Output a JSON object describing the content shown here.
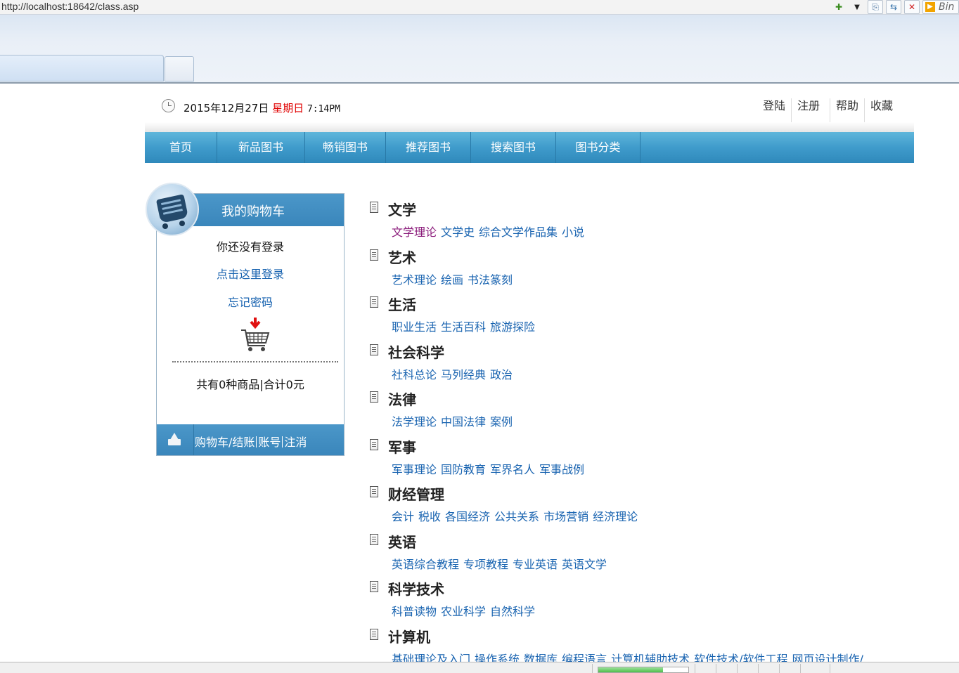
{
  "browser": {
    "url": "http://localhost:18642/class.asp",
    "right_tag": "Bin"
  },
  "topbar": {
    "date": "2015年12月27日",
    "weekday": "星期日",
    "time": "7:14PM",
    "links": [
      "登陆",
      "注册",
      "帮助",
      "收藏"
    ]
  },
  "nav": {
    "items": [
      "首页",
      "新品图书",
      "畅销图书",
      "推荐图书",
      "搜索图书",
      "图书分类"
    ]
  },
  "cart": {
    "title": "我的购物车",
    "not_logged_in": "你还没有登录",
    "login_link": "点击这里登录",
    "forgot_link": "忘记密码",
    "summary": "共有0种商品|合计0元",
    "footer_links": [
      "购物车/结账",
      "账号",
      "注消"
    ]
  },
  "categories": [
    {
      "title": "文学",
      "subs": [
        "文学理论",
        "文学史",
        "综合文学作品集",
        "小说"
      ]
    },
    {
      "title": "艺术",
      "subs": [
        "艺术理论",
        "绘画",
        "书法篆刻"
      ]
    },
    {
      "title": "生活",
      "subs": [
        "职业生活",
        "生活百科",
        "旅游探险"
      ]
    },
    {
      "title": "社会科学",
      "subs": [
        "社科总论",
        "马列经典",
        "政治"
      ]
    },
    {
      "title": "法律",
      "subs": [
        "法学理论",
        "中国法律",
        "案例"
      ]
    },
    {
      "title": "军事",
      "subs": [
        "军事理论",
        "国防教育",
        "军界名人",
        "军事战例"
      ]
    },
    {
      "title": "财经管理",
      "subs": [
        "会计",
        "税收",
        "各国经济",
        "公共关系",
        "市场营销",
        "经济理论"
      ]
    },
    {
      "title": "英语",
      "subs": [
        "英语综合教程",
        "专项教程",
        "专业英语",
        "英语文学"
      ]
    },
    {
      "title": "科学技术",
      "subs": [
        "科普读物",
        "农业科学",
        "自然科学"
      ]
    },
    {
      "title": "计算机",
      "subs": [
        "基础理论及入门",
        "操作系统",
        "数据库",
        "编程语言",
        "计算机辅助技术",
        "软件技术/软件工程",
        "网页设计制作/"
      ]
    }
  ],
  "colors": {
    "nav_blue": "#3f9bcb",
    "link_blue": "#1863b0",
    "weekday_red": "#e00000",
    "visited_purple": "#8a1a7a"
  },
  "status": {
    "progress": 0.72
  }
}
